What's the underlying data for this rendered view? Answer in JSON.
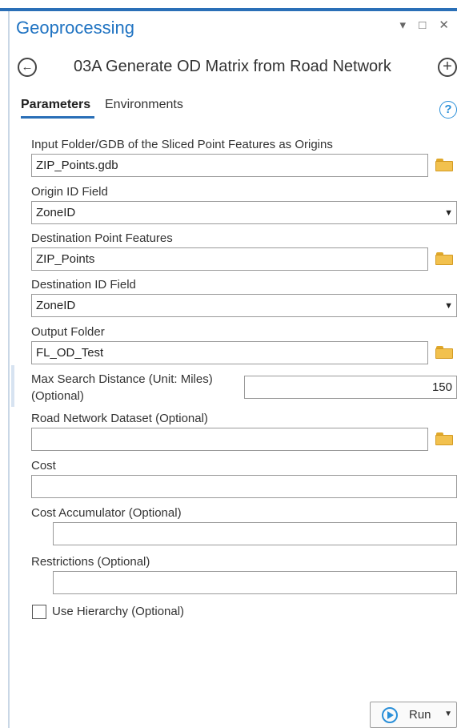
{
  "pane": {
    "title": "Geoprocessing",
    "window_controls": "▾ □ ✕"
  },
  "tool": {
    "back_glyph": "←",
    "name": "03A Generate OD Matrix from Road Network",
    "add_glyph": "+"
  },
  "tabs": {
    "parameters": "Parameters",
    "environments": "Environments",
    "help_glyph": "?"
  },
  "params": {
    "input_label": "Input Folder/GDB of the Sliced Point Features as Origins",
    "input_value": "ZIP_Points.gdb",
    "origin_id_label": "Origin ID Field",
    "origin_id_value": "ZoneID",
    "dest_points_label": "Destination Point Features",
    "dest_points_value": "ZIP_Points",
    "dest_id_label": "Destination ID Field",
    "dest_id_value": "ZoneID",
    "output_folder_label": "Output Folder",
    "output_folder_value": "FL_OD_Test",
    "max_search_label_line1": "Max Search Distance (Unit: Miles)",
    "max_search_label_line2": "(Optional)",
    "max_search_value": "150",
    "road_network_label": "Road Network Dataset (Optional)",
    "road_network_value": "",
    "cost_label": "Cost",
    "cost_value": "",
    "cost_accumulator_label": "Cost Accumulator (Optional)",
    "cost_accumulator_value": "",
    "restrictions_label": "Restrictions (Optional)",
    "restrictions_value": "",
    "use_hierarchy_label": "Use Hierarchy (Optional)",
    "use_hierarchy_checked": false,
    "dropdown_glyph": "▼"
  },
  "footer": {
    "run_label": "Run",
    "run_dropdown_glyph": "▼"
  },
  "colors": {
    "accent": "#2a6fb7",
    "title": "#1f73c2",
    "folder": "#f2c14e"
  }
}
